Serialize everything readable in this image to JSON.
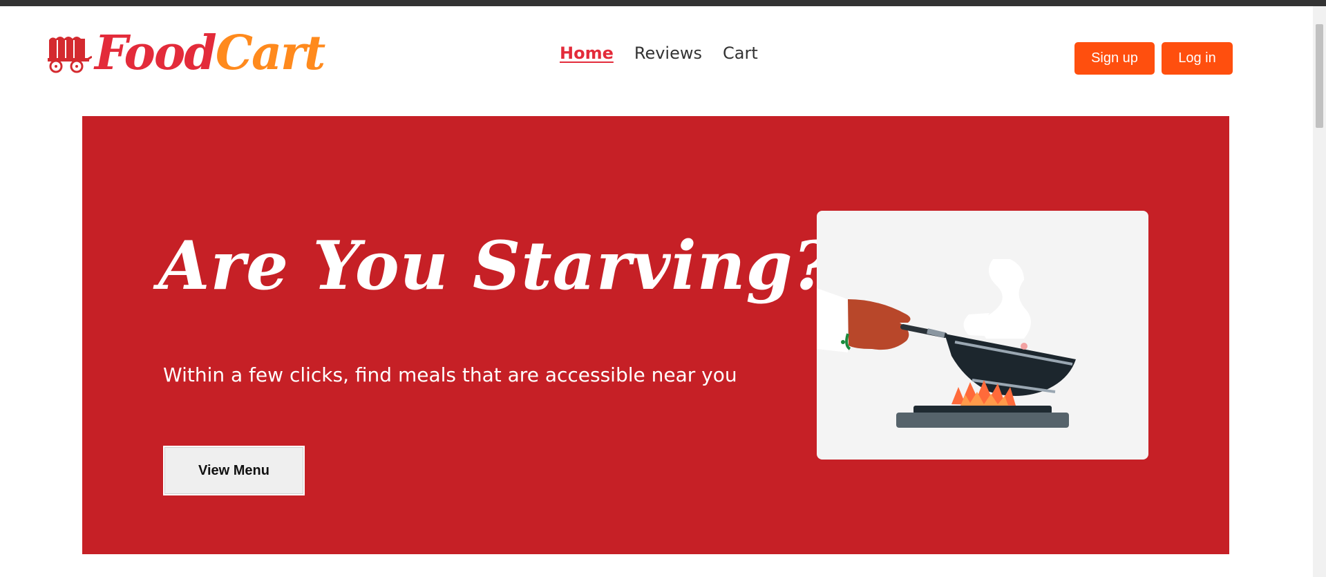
{
  "brand": {
    "name_part1": "Food",
    "name_part2": "Cart",
    "logo_icon": "wagon-icon"
  },
  "nav": {
    "items": [
      {
        "label": "Home",
        "active": true
      },
      {
        "label": "Reviews",
        "active": false
      },
      {
        "label": "Cart",
        "active": false
      }
    ]
  },
  "auth": {
    "signup_label": "Sign up",
    "login_label": "Log in"
  },
  "hero": {
    "title": "Are You Starving?",
    "subtitle": "Within a few clicks, find meals that are accessible near you",
    "button_label": "View Menu",
    "illustration": "cooking-wok-illustration"
  },
  "colors": {
    "brand_red": "#e32b3a",
    "brand_orange": "#ff8a1d",
    "button_orange": "#ff4f0e",
    "hero_red": "#c62026"
  }
}
